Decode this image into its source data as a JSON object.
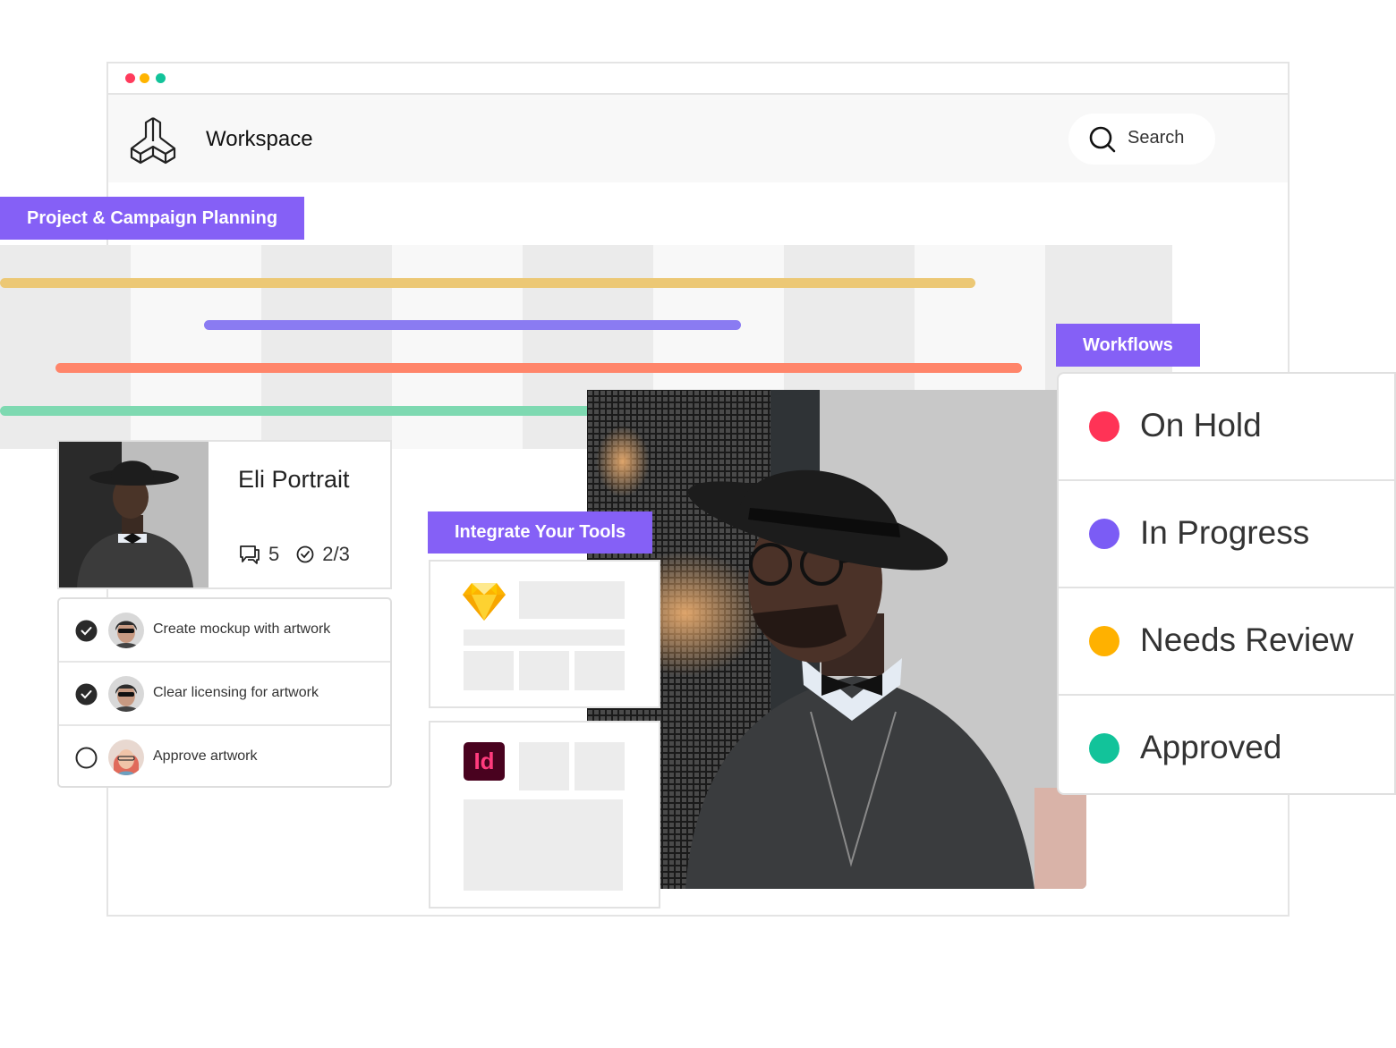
{
  "window": {
    "dots": [
      "#ff3b5c",
      "#ffb400",
      "#12c39a"
    ]
  },
  "header": {
    "title": "Workspace",
    "search_label": "Search"
  },
  "planning": {
    "label": "Project & Campaign Planning"
  },
  "portrait_card": {
    "title": "Eli Portrait",
    "comments": "5",
    "tasks_done": "2/3"
  },
  "tasks": [
    {
      "label": "Create mockup with artwork",
      "done": true
    },
    {
      "label": "Clear licensing for artwork",
      "done": true
    },
    {
      "label": "Approve artwork",
      "done": false
    }
  ],
  "integrations": {
    "label": "Integrate Your Tools",
    "tools": [
      "sketch-logo",
      "indesign-logo"
    ],
    "indesign_text": "Id"
  },
  "workflows": {
    "label": "Workflows",
    "items": [
      {
        "label": "On Hold",
        "color": "#ff3356"
      },
      {
        "label": "In Progress",
        "color": "#7b5cf5"
      },
      {
        "label": "Needs Review",
        "color": "#ffb100"
      },
      {
        "label": "Approved",
        "color": "#12c39a"
      }
    ]
  },
  "colors": {
    "accent": "#8560f6",
    "bar_yellow": "#ecc875",
    "bar_purple": "#8a7bf2",
    "bar_orange": "#ff856a",
    "bar_green": "#7ed9b1"
  }
}
